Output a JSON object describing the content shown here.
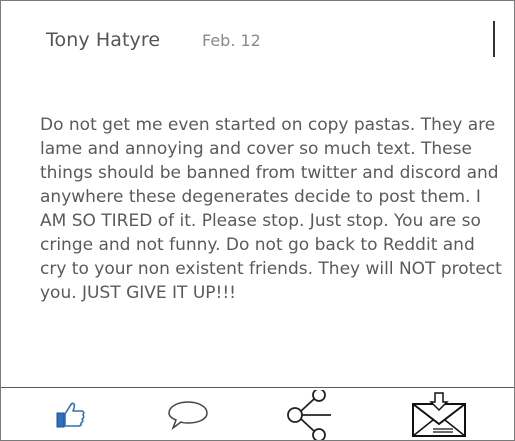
{
  "post": {
    "author": "Tony Hatyre",
    "date": "Feb. 12",
    "body": "Do not get me even started on copy pastas. They are lame and annoying and cover so much text. These things should be banned from twitter and discord and anywhere these degenerates decide to post them. I AM SO TIRED of it. Please stop. Just stop. You are so cringe and not funny. Do not go back to Reddit and cry to your non existent friends. They will NOT protect you. JUST GIVE IT UP!!!"
  },
  "actions": {
    "like_icon": "thumbs-up-icon",
    "comment_icon": "speech-bubble-icon",
    "share_icon": "share-icon",
    "save_icon": "envelope-download-icon"
  },
  "colors": {
    "like_blue": "#2f6fc0",
    "text": "#5a5a5a",
    "border": "#7a7a7a"
  }
}
